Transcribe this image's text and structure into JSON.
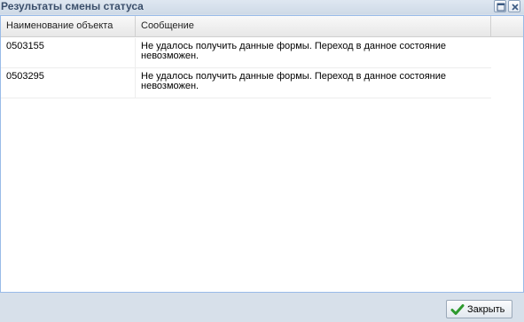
{
  "window": {
    "title": "Результаты смены статуса"
  },
  "grid": {
    "columns": [
      "Наименование объекта",
      "Сообщение"
    ],
    "rows": [
      {
        "object": "0503155",
        "message_line1": "Не удалось получить данные формы. Переход в данное состояние",
        "message_line2": "невозможен."
      },
      {
        "object": "0503295",
        "message_line1": "Не удалось получить данные формы. Переход в данное состояние",
        "message_line2": "невозможен."
      }
    ]
  },
  "footer": {
    "close_label": "Закрыть"
  },
  "colors": {
    "window_frame": "#d7e0ea",
    "title_text": "#3b4f6b",
    "check_icon": "#2e9a2e"
  },
  "icons": {
    "maximize": "maximize-icon",
    "close": "close-icon",
    "button": "check-icon"
  }
}
